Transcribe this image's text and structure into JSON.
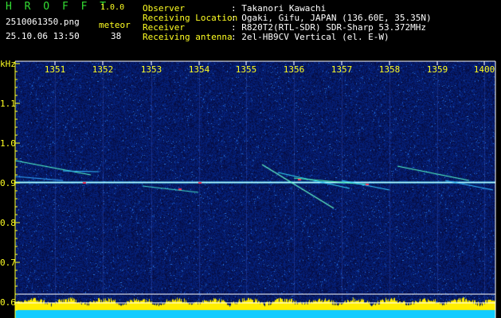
{
  "app": {
    "title": "H R O F F T",
    "version": "1.0.0"
  },
  "file": {
    "name": "2510061350.png",
    "datetime": "25.10.06 13:50"
  },
  "meteor": {
    "label": "meteor",
    "count": "38"
  },
  "info": [
    {
      "key": "Observer",
      "value": ": Takanori Kawachi"
    },
    {
      "key": "Receiving Location",
      "value": ": Ogaki, Gifu, JAPAN (136.60E, 35.35N)"
    },
    {
      "key": "Receiver",
      "value": ": R820T2(RTL-SDR) SDR-Sharp 53.372MHz"
    },
    {
      "key": "Receiving antenna",
      "value": ": 2el-HB9CV Vertical (el. E-W)"
    }
  ],
  "axis": {
    "y_unit": "kHz",
    "x_ticks": [
      "1351",
      "1352",
      "1353",
      "1354",
      "1355",
      "1356",
      "1357",
      "1358",
      "1359",
      "1400"
    ],
    "y_ticks": [
      "1.1",
      "1.0",
      "0.9",
      "0.8",
      "0.7",
      "0.6"
    ]
  },
  "colors": {
    "label_green": "#33dd33",
    "label_yellow": "#ffff22",
    "background": "#0a0a5a",
    "activity": "#ffee00",
    "baseline": "#11ccff"
  }
}
